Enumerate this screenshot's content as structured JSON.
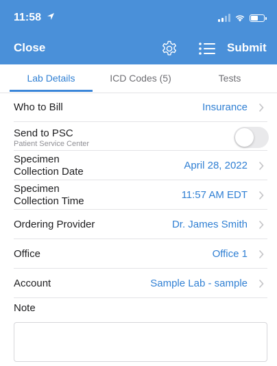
{
  "status_bar": {
    "time": "11:58",
    "battery_level": 0.6
  },
  "nav": {
    "close_label": "Close",
    "settings_icon": "gear-icon",
    "list_icon": "list-icon",
    "submit_label": "Submit"
  },
  "tabs": [
    {
      "label": "Lab Details",
      "active": true
    },
    {
      "label": "ICD Codes (5)",
      "active": false
    },
    {
      "label": "Tests",
      "active": false
    }
  ],
  "rows": {
    "bill": {
      "label": "Who to Bill",
      "value": "Insurance"
    },
    "psc": {
      "label": "Send to PSC",
      "sublabel": "Patient Service Center",
      "toggle_on": false
    },
    "date": {
      "label_line1": "Specimen",
      "label_line2": "Collection Date",
      "value": "April 28, 2022"
    },
    "time": {
      "label_line1": "Specimen",
      "label_line2": "Collection Time",
      "value": "11:57 AM EDT"
    },
    "provider": {
      "label": "Ordering Provider",
      "value": "Dr. James Smith"
    },
    "office": {
      "label": "Office",
      "value": "Office 1"
    },
    "account": {
      "label": "Account",
      "value": "Sample Lab - sample"
    }
  },
  "note": {
    "label": "Note",
    "value": ""
  },
  "colors": {
    "header": "#4a90d9",
    "accent": "#2f7fd3",
    "divider": "#e3e3e6"
  }
}
